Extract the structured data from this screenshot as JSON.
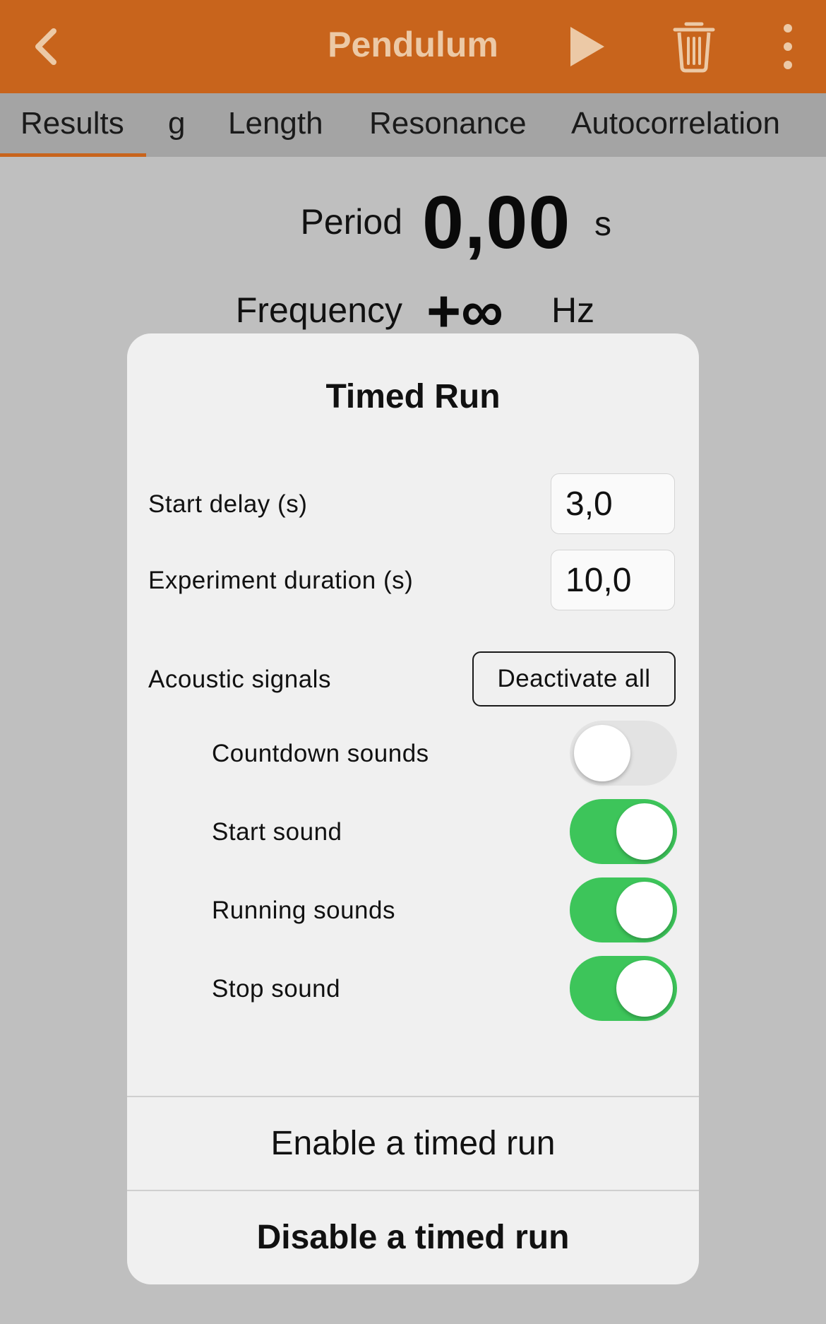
{
  "toolbar": {
    "title": "Pendulum",
    "background_color": "#c8641c",
    "icons": [
      "back-chevron-icon",
      "play-icon",
      "trash-icon",
      "more-vertical-icon"
    ]
  },
  "tabs": [
    {
      "label": "Results",
      "selected": true
    },
    {
      "label": "g",
      "selected": false
    },
    {
      "label": "Length",
      "selected": false
    },
    {
      "label": "Resonance",
      "selected": false
    },
    {
      "label": "Autocorrelation",
      "selected": false
    }
  ],
  "results": {
    "period_label": "Period",
    "period_value": "0,00",
    "period_unit": "s",
    "frequency_label": "Frequency",
    "frequency_value": "+∞",
    "frequency_unit": "Hz"
  },
  "timed_run": {
    "title": "Timed Run",
    "start_delay_label": "Start delay (s)",
    "start_delay_value": "3,0",
    "duration_label": "Experiment duration (s)",
    "duration_value": "10,0",
    "acoustic_label": "Acoustic signals",
    "deactivate_all_label": "Deactivate all",
    "sounds": [
      {
        "label": "Countdown sounds",
        "enabled": false
      },
      {
        "label": "Start sound",
        "enabled": true
      },
      {
        "label": "Running sounds",
        "enabled": true
      },
      {
        "label": "Stop sound",
        "enabled": true
      }
    ],
    "toggle_on_color": "#3dc55a",
    "enable_label": "Enable a timed run",
    "disable_label": "Disable a timed run"
  }
}
